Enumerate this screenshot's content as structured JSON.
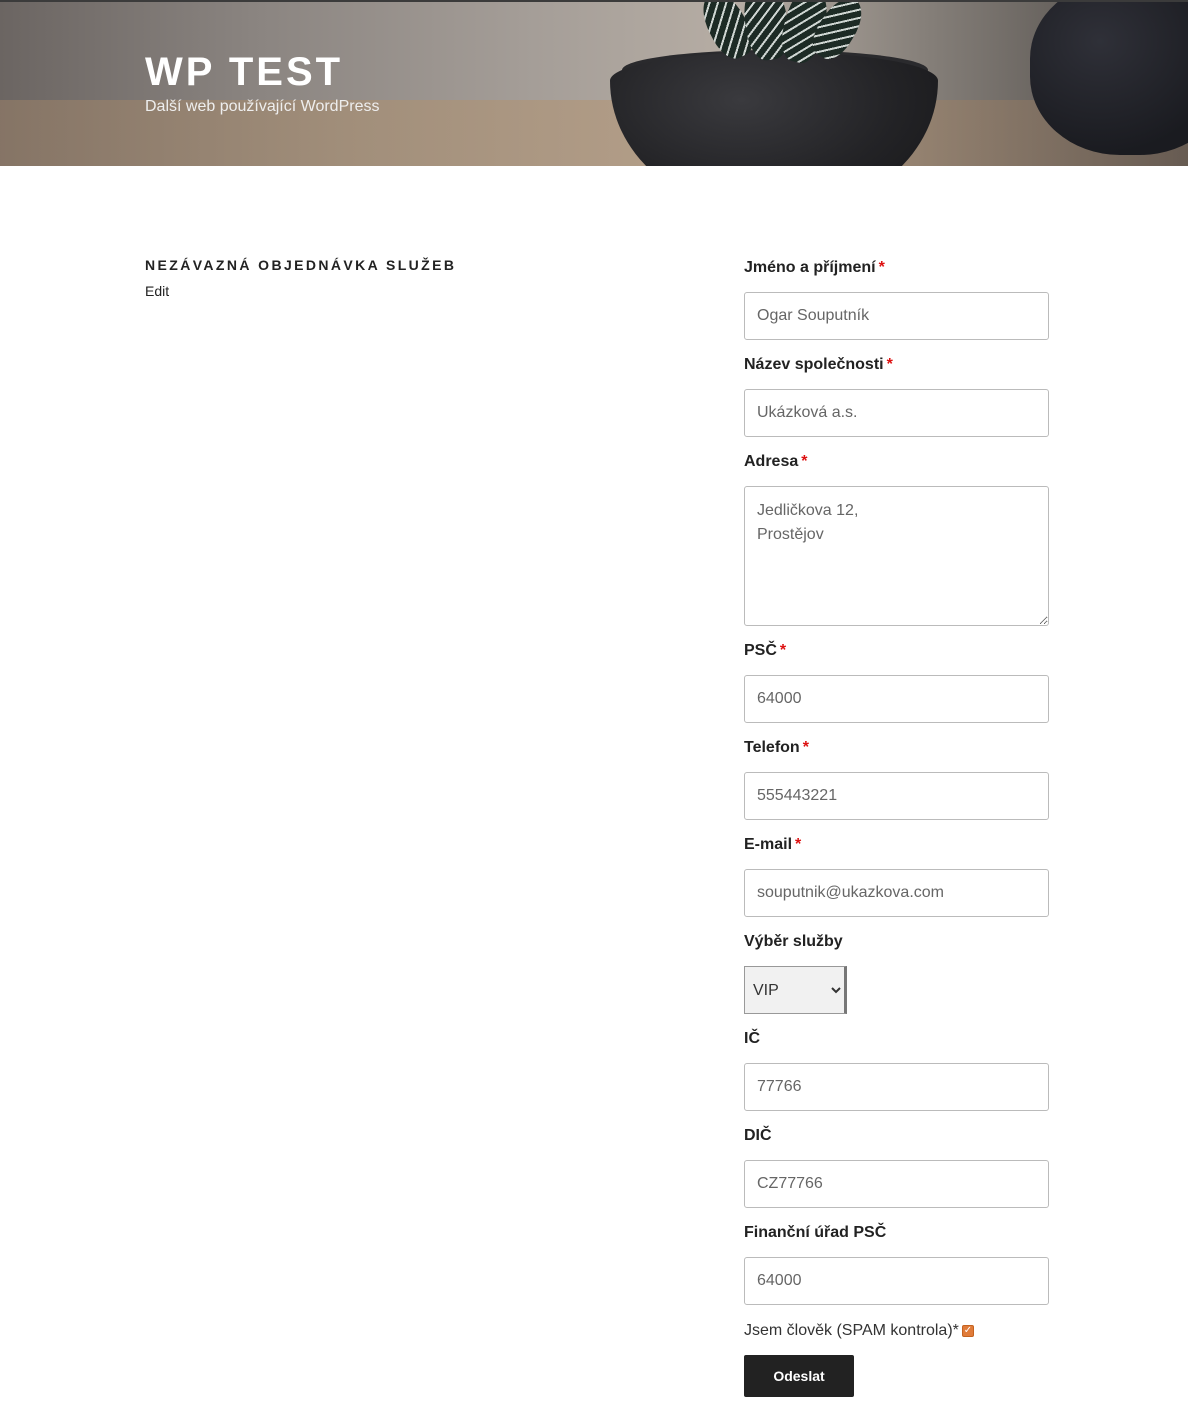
{
  "header": {
    "site_title": "WP TEST",
    "tagline": "Další web používající WordPress"
  },
  "page": {
    "title": "NEZÁVAZNÁ OBJEDNÁVKA SLUŽEB",
    "edit_label": "Edit"
  },
  "form": {
    "required_mark": "*",
    "name": {
      "label": "Jméno a příjmení",
      "value": "Ogar Souputník"
    },
    "company": {
      "label": "Název společnosti",
      "value": "Ukázková a.s."
    },
    "address": {
      "label": "Adresa",
      "value": "Jedličkova 12,\nProstějov"
    },
    "zip": {
      "label": "PSČ",
      "value": "64000"
    },
    "phone": {
      "label": "Telefon",
      "value": "555443221"
    },
    "email": {
      "label": "E-mail",
      "value": "souputnik@ukazkova.com"
    },
    "service": {
      "label": "Výběr služby",
      "selected": "VIP"
    },
    "ic": {
      "label": "IČ",
      "value": "77766"
    },
    "dic": {
      "label": "DIČ",
      "value": "CZ77766"
    },
    "tax_office_zip": {
      "label": "Finanční úřad PSČ",
      "value": "64000"
    },
    "spam_check": {
      "label": "Jsem člověk (SPAM kontrola)",
      "checked": true
    },
    "submit_label": "Odeslat"
  },
  "colors": {
    "required": "#dd1111",
    "button_bg": "#222222",
    "checkbox": "#e07b39"
  }
}
